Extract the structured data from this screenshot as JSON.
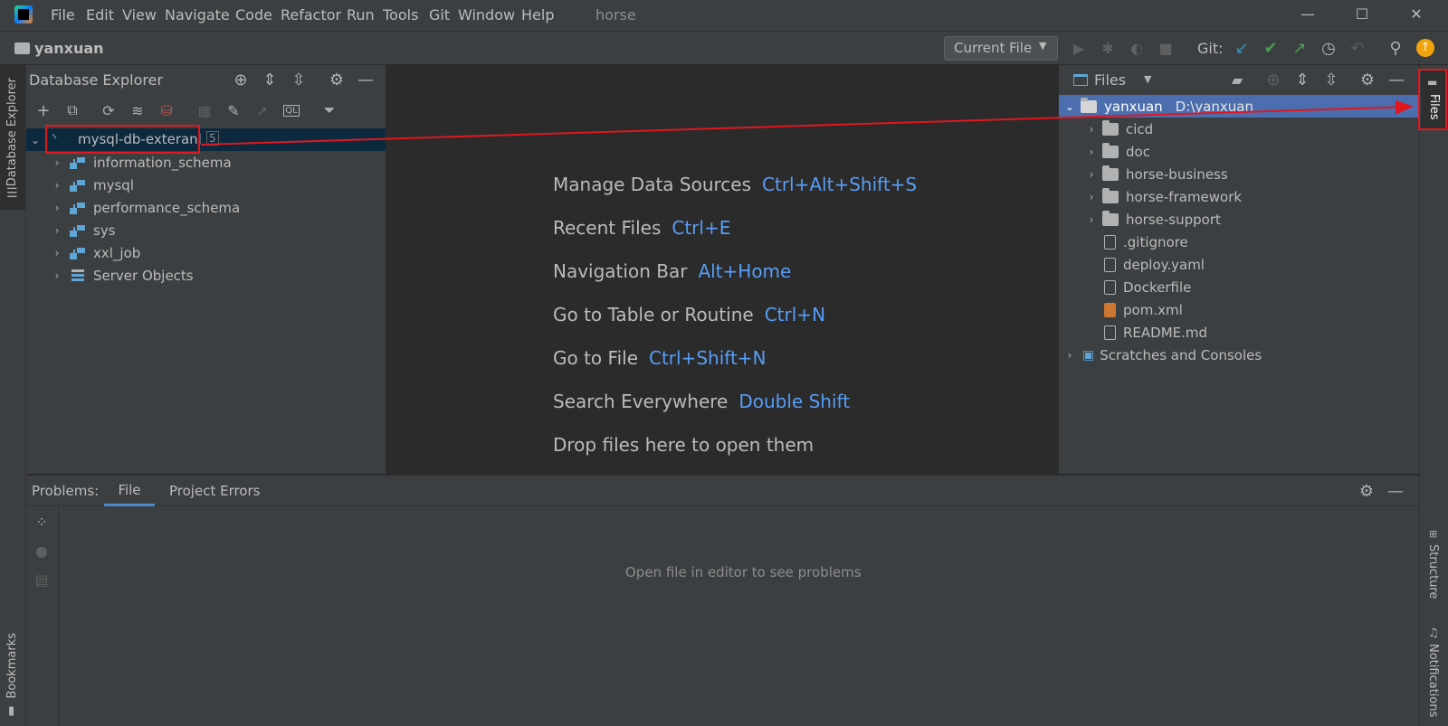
{
  "window": {
    "title": "horse",
    "menu": [
      "File",
      "Edit",
      "View",
      "Navigate",
      "Code",
      "Refactor",
      "Run",
      "Tools",
      "Git",
      "Window",
      "Help"
    ]
  },
  "navbar": {
    "project": "yanxuan",
    "run_config": "Current File",
    "git_label": "Git:"
  },
  "left_strip": {
    "database_explorer": "Database Explorer",
    "bookmarks": "Bookmarks"
  },
  "right_strip": {
    "files": "Files",
    "structure": "Structure",
    "notifications": "Notifications"
  },
  "db_explorer": {
    "title": "Database Explorer",
    "datasource": {
      "name": "mysql-db-exteranl",
      "count": "5"
    },
    "schemas": [
      "information_schema",
      "mysql",
      "performance_schema",
      "sys",
      "xxl_job"
    ],
    "server_objects": "Server Objects"
  },
  "editor": {
    "hints": [
      {
        "label": "Manage Data Sources",
        "key": "Ctrl+Alt+Shift+S"
      },
      {
        "label": "Recent Files",
        "key": "Ctrl+E"
      },
      {
        "label": "Navigation Bar",
        "key": "Alt+Home"
      },
      {
        "label": "Go to Table or Routine",
        "key": "Ctrl+N"
      },
      {
        "label": "Go to File",
        "key": "Ctrl+Shift+N"
      },
      {
        "label": "Search Everywhere",
        "key": "Double Shift"
      }
    ],
    "drop_text": "Drop files here to open them"
  },
  "files_panel": {
    "title": "Files",
    "root": {
      "name": "yanxuan",
      "path": "D:\\yanxuan"
    },
    "folders": [
      "cicd",
      "doc",
      "horse-business",
      "horse-framework",
      "horse-support"
    ],
    "files": [
      ".gitignore",
      "deploy.yaml",
      "Dockerfile",
      "pom.xml",
      "README.md"
    ],
    "scratches": "Scratches and Consoles"
  },
  "problems": {
    "label": "Problems:",
    "tabs": [
      "File",
      "Project Errors"
    ],
    "empty_text": "Open file in editor to see problems"
  },
  "colors": {
    "accent": "#589df6",
    "selection": "#4b6eaf",
    "annotation": "#e0171f",
    "panel": "#3c3f41",
    "editor": "#2b2b2b"
  }
}
